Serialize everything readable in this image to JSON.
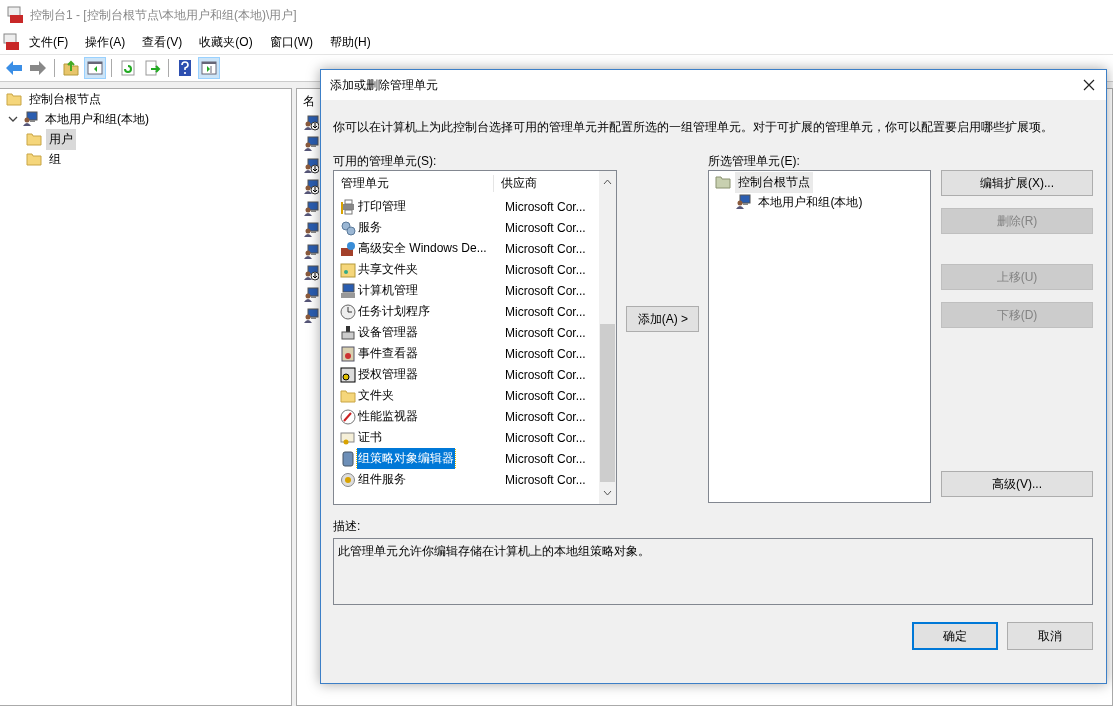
{
  "window": {
    "title": "控制台1 - [控制台根节点\\本地用户和组(本地)\\用户]"
  },
  "menu": [
    "文件(F)",
    "操作(A)",
    "查看(V)",
    "收藏夹(O)",
    "窗口(W)",
    "帮助(H)"
  ],
  "toolbar": [
    {
      "kind": "back",
      "on": false
    },
    {
      "kind": "forward",
      "on": false
    },
    {
      "kind": "sep"
    },
    {
      "kind": "up",
      "on": false
    },
    {
      "kind": "tree",
      "on": true
    },
    {
      "kind": "sep"
    },
    {
      "kind": "refresh",
      "on": false
    },
    {
      "kind": "export",
      "on": false
    },
    {
      "kind": "sep"
    },
    {
      "kind": "help",
      "on": false
    },
    {
      "kind": "action",
      "on": true
    }
  ],
  "tree": [
    {
      "label": "控制台根节点",
      "kind": "folder",
      "selected": false
    },
    {
      "label": "本地用户和组(本地)",
      "kind": "users",
      "expanded": true,
      "selected": false,
      "children": [
        {
          "label": "用户",
          "kind": "folder",
          "selected": true
        },
        {
          "label": "组",
          "kind": "folder",
          "selected": false
        }
      ]
    }
  ],
  "result_pane": {
    "column_1": "名",
    "rows": [
      {
        "disabled": true
      },
      {
        "disabled": false
      },
      {
        "disabled": true
      },
      {
        "disabled": true
      },
      {
        "disabled": false
      },
      {
        "disabled": false
      },
      {
        "disabled": false
      },
      {
        "disabled": true
      },
      {
        "disabled": false
      },
      {
        "disabled": false
      }
    ]
  },
  "dialog": {
    "title": "添加或删除管理单元",
    "intro": "你可以在计算机上为此控制台选择可用的管理单元并配置所选的一组管理单元。对于可扩展的管理单元，你可以配置要启用哪些扩展项。",
    "available_label": "可用的管理单元(S):",
    "available": {
      "columns": [
        "管理单元",
        "供应商"
      ],
      "rows": [
        {
          "name": "打印管理",
          "vendor": "Microsoft Cor...",
          "selected": false
        },
        {
          "name": "服务",
          "vendor": "Microsoft Cor...",
          "selected": false
        },
        {
          "name": "高级安全 Windows De...",
          "vendor": "Microsoft Cor...",
          "selected": false
        },
        {
          "name": "共享文件夹",
          "vendor": "Microsoft Cor...",
          "selected": false
        },
        {
          "name": "计算机管理",
          "vendor": "Microsoft Cor...",
          "selected": false
        },
        {
          "name": "任务计划程序",
          "vendor": "Microsoft Cor...",
          "selected": false
        },
        {
          "name": "设备管理器",
          "vendor": "Microsoft Cor...",
          "selected": false
        },
        {
          "name": "事件查看器",
          "vendor": "Microsoft Cor...",
          "selected": false
        },
        {
          "name": "授权管理器",
          "vendor": "Microsoft Cor...",
          "selected": false
        },
        {
          "name": "文件夹",
          "vendor": "Microsoft Cor...",
          "selected": false
        },
        {
          "name": "性能监视器",
          "vendor": "Microsoft Cor...",
          "selected": false
        },
        {
          "name": "证书",
          "vendor": "Microsoft Cor...",
          "selected": false
        },
        {
          "name": "组策略对象编辑器",
          "vendor": "Microsoft Cor...",
          "selected": true
        },
        {
          "name": "组件服务",
          "vendor": "Microsoft Cor...",
          "selected": false
        }
      ]
    },
    "add_button": "添加(A) >",
    "selected_label": "所选管理单元(E):",
    "selected_tree": [
      {
        "label": "控制台根节点",
        "kind": "folder",
        "selected": true,
        "children": [
          {
            "label": "本地用户和组(本地)",
            "kind": "users",
            "selected": false
          }
        ]
      }
    ],
    "side_buttons": [
      {
        "label": "编辑扩展(X)...",
        "disabled": false
      },
      {
        "label": "删除(R)",
        "disabled": true
      },
      {
        "label": "上移(U)",
        "disabled": true
      },
      {
        "label": "下移(D)",
        "disabled": true
      },
      {
        "label": "高级(V)...",
        "disabled": false
      }
    ],
    "description_label": "描述:",
    "description": "此管理单元允许你编辑存储在计算机上的本地组策略对象。",
    "buttons": [
      {
        "label": "确定",
        "default": true
      },
      {
        "label": "取消",
        "default": false
      }
    ]
  }
}
